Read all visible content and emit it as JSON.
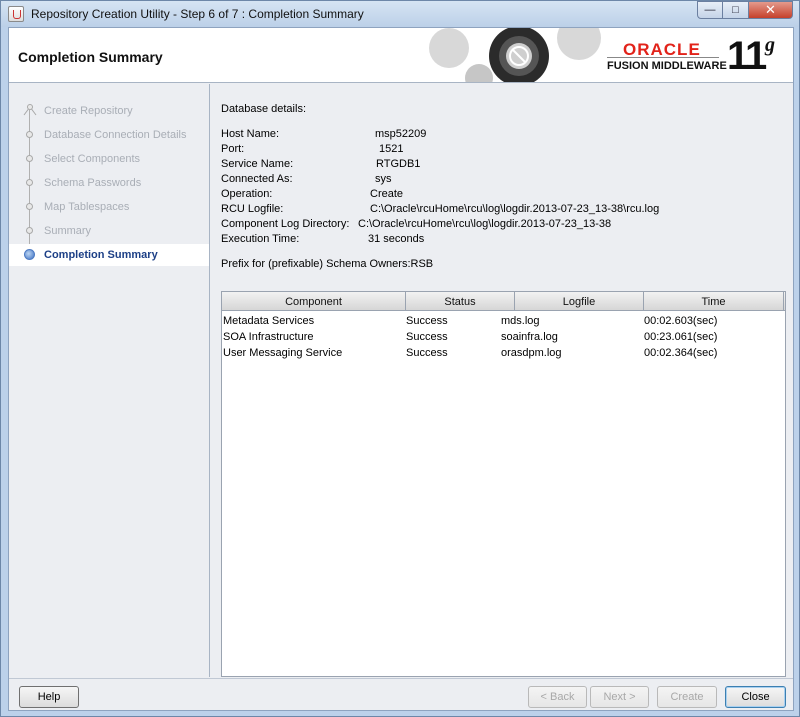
{
  "window": {
    "title": "Repository Creation Utility - Step 6 of 7 : Completion Summary"
  },
  "header": {
    "title": "Completion Summary",
    "brand": "ORACLE",
    "product": "FUSION MIDDLEWARE",
    "version_number": "11",
    "version_suffix": "g"
  },
  "nav": {
    "items": [
      {
        "label": "Create Repository",
        "state": "done"
      },
      {
        "label": "Database Connection Details",
        "state": "done"
      },
      {
        "label": "Select Components",
        "state": "done"
      },
      {
        "label": "Schema Passwords",
        "state": "done"
      },
      {
        "label": "Map Tablespaces",
        "state": "done"
      },
      {
        "label": "Summary",
        "state": "done"
      },
      {
        "label": "Completion Summary",
        "state": "active"
      }
    ]
  },
  "details": {
    "title": "Database details:",
    "fields": [
      {
        "key": "Host Name:",
        "value": "msp52209"
      },
      {
        "key": "Port:",
        "value": "1521"
      },
      {
        "key": "Service Name:",
        "value": "RTGDB1"
      },
      {
        "key": "Connected As:",
        "value": "sys"
      },
      {
        "key": "Operation:",
        "value": "Create"
      },
      {
        "key": "RCU Logfile:",
        "value": "C:\\Oracle\\rcuHome\\rcu\\log\\logdir.2013-07-23_13-38\\rcu.log"
      },
      {
        "key": "Component Log Directory:",
        "value": "C:\\Oracle\\rcuHome\\rcu\\log\\logdir.2013-07-23_13-38"
      },
      {
        "key": "Execution Time:",
        "value": "31  seconds"
      }
    ],
    "prefix": "Prefix for (prefixable) Schema Owners:RSB"
  },
  "table": {
    "columns": [
      "Component",
      "Status",
      "Logfile",
      "Time"
    ],
    "rows": [
      [
        "Metadata Services",
        "Success",
        "mds.log",
        "00:02.603(sec)"
      ],
      [
        "SOA Infrastructure",
        "Success",
        "soainfra.log",
        "00:23.061(sec)"
      ],
      [
        "User Messaging Service",
        "Success",
        "orasdpm.log",
        "00:02.364(sec)"
      ]
    ]
  },
  "footer": {
    "help": "Help",
    "back": "< Back",
    "next": "Next >",
    "create": "Create",
    "close": "Close"
  }
}
